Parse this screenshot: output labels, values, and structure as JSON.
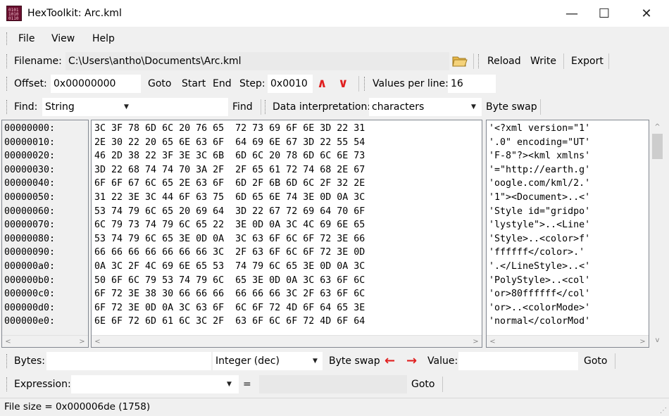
{
  "window": {
    "title": "HexToolkit: Arc.kml",
    "minimize": "—",
    "maximize": "☐",
    "close": "✕"
  },
  "menu": [
    "File",
    "View",
    "Help"
  ],
  "file_bar": {
    "label": "Filename:",
    "path": "C:\\Users\\antho\\Documents\\Arc.kml",
    "reload": "Reload",
    "write": "Write",
    "export": "Export"
  },
  "nav_bar": {
    "offset_label": "Offset:",
    "offset_value": "0x00000000",
    "goto": "Goto",
    "start": "Start",
    "end": "End",
    "step_label": "Step:",
    "step_value": "0x0010",
    "up": "∧",
    "down": "∨",
    "vpl_label": "Values per line:",
    "vpl_value": "16"
  },
  "find_bar": {
    "label": "Find:",
    "mode": "String",
    "value": "",
    "find_button": "Find",
    "interp_label": "Data interpretation:",
    "interp_value": "characters",
    "byte_swap": "Byte swap"
  },
  "hex": {
    "offsets": [
      "00000000:",
      "00000010:",
      "00000020:",
      "00000030:",
      "00000040:",
      "00000050:",
      "00000060:",
      "00000070:",
      "00000080:",
      "00000090:",
      "000000a0:",
      "000000b0:",
      "000000c0:",
      "000000d0:",
      "000000e0:"
    ],
    "bytes": [
      "3C 3F 78 6D 6C 20 76 65  72 73 69 6F 6E 3D 22 31",
      "2E 30 22 20 65 6E 63 6F  64 69 6E 67 3D 22 55 54",
      "46 2D 38 22 3F 3E 3C 6B  6D 6C 20 78 6D 6C 6E 73",
      "3D 22 68 74 74 70 3A 2F  2F 65 61 72 74 68 2E 67",
      "6F 6F 67 6C 65 2E 63 6F  6D 2F 6B 6D 6C 2F 32 2E",
      "31 22 3E 3C 44 6F 63 75  6D 65 6E 74 3E 0D 0A 3C",
      "53 74 79 6C 65 20 69 64  3D 22 67 72 69 64 70 6F",
      "6C 79 73 74 79 6C 65 22  3E 0D 0A 3C 4C 69 6E 65",
      "53 74 79 6C 65 3E 0D 0A  3C 63 6F 6C 6F 72 3E 66",
      "66 66 66 66 66 66 66 3C  2F 63 6F 6C 6F 72 3E 0D",
      "0A 3C 2F 4C 69 6E 65 53  74 79 6C 65 3E 0D 0A 3C",
      "50 6F 6C 79 53 74 79 6C  65 3E 0D 0A 3C 63 6F 6C",
      "6F 72 3E 38 30 66 66 66  66 66 66 3C 2F 63 6F 6C",
      "6F 72 3E 0D 0A 3C 63 6F  6C 6F 72 4D 6F 64 65 3E",
      "6E 6F 72 6D 61 6C 3C 2F  63 6F 6C 6F 72 4D 6F 64"
    ],
    "chars": [
      "'<?xml version=\"1'",
      "'.0\" encoding=\"UT'",
      "'F-8\"?><kml xmlns'",
      "'=\"http://earth.g'",
      "'oogle.com/kml/2.'",
      "'1\"><Document>..<'",
      "'Style id=\"gridpo'",
      "'lystyle\">..<Line'",
      "'Style>..<color>f'",
      "'ffffff</color>.'",
      "'.</LineStyle>..<'",
      "'PolyStyle>..<col'",
      "'or>80ffffff</col'",
      "'or>..<colorMode>'",
      "'normal</colorMod'"
    ]
  },
  "bytes_bar": {
    "label": "Bytes:",
    "value": "",
    "type": "Integer (dec)",
    "byte_swap": "Byte swap",
    "value_label": "Value:",
    "value_value": "",
    "goto": "Goto"
  },
  "expr_bar": {
    "label": "Expression:",
    "value": "",
    "equals": "=",
    "result": "",
    "goto": "Goto"
  },
  "status": {
    "text": "File size = 0x000006de (1758)"
  },
  "colors": {
    "accent_arrows": "#e02020",
    "icon_bg": "#6b1030"
  }
}
